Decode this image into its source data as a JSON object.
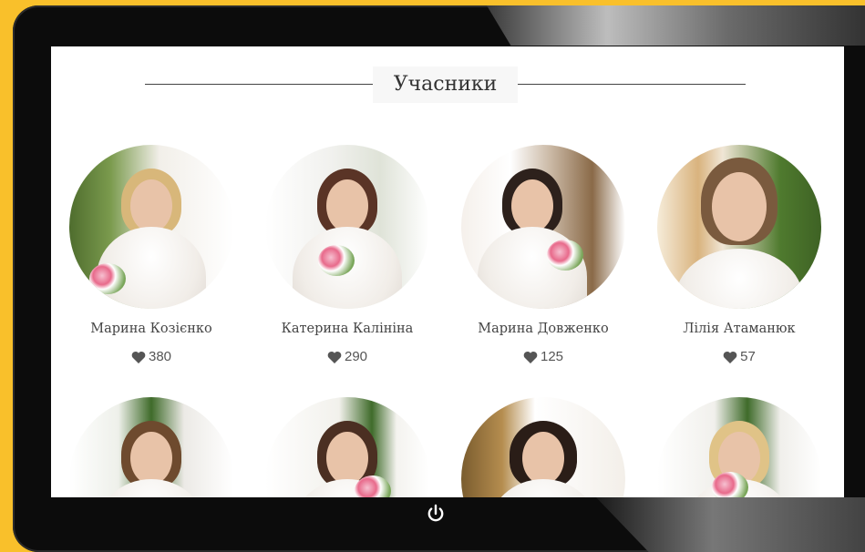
{
  "section_title": "Учасники",
  "participants_row1": [
    {
      "name": "Марина Козієнко",
      "votes": "380"
    },
    {
      "name": "Катерина Калініна",
      "votes": "290"
    },
    {
      "name": "Марина Довженко",
      "votes": "125"
    },
    {
      "name": "Лілія Атаманюк",
      "votes": "57"
    }
  ],
  "colors": {
    "frame": "#f9c02b",
    "device": "#0c0c0c",
    "heart": "#555555"
  },
  "icons": {
    "vote": "heart-icon",
    "device_button": "power-icon"
  }
}
